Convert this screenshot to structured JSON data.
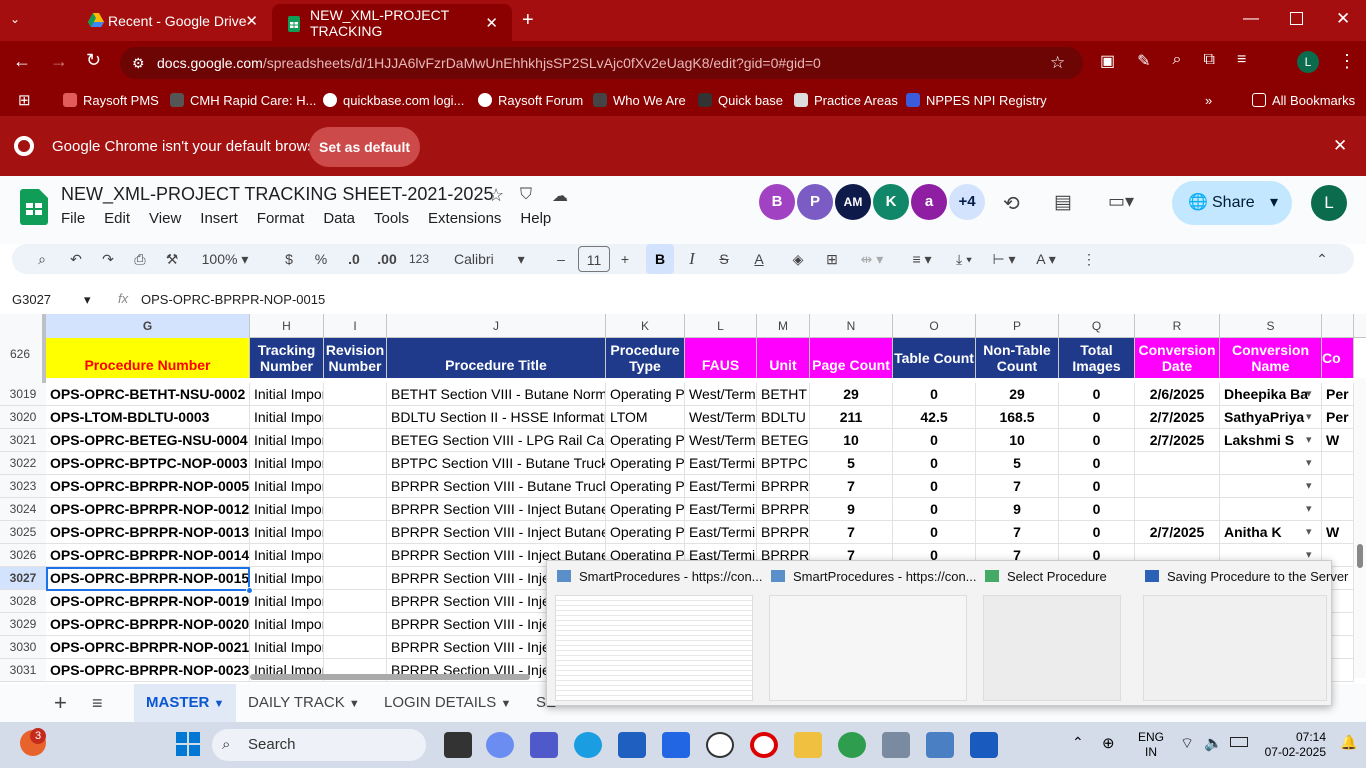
{
  "browser": {
    "tabs": [
      {
        "label": "Recent - Google Drive",
        "active": false
      },
      {
        "label": "NEW_XML-PROJECT TRACKING",
        "active": true
      }
    ],
    "url_host": "docs.google.com",
    "url_path": "/spreadsheets/d/1HJJA6lvFzrDaMwUnEhhkhjsSP2SLvAjc0fXv2eUagK8/edit?gid=0#gid=0",
    "bookmarks": [
      "Raysoft PMS",
      "CMH Rapid Care: H...",
      "quickbase.com logi...",
      "Raysoft Forum",
      "Who We Are",
      "Quick base",
      "Practice Areas",
      "NPPES NPI Registry"
    ],
    "all_bookmarks": "All Bookmarks",
    "infobar_text": "Google Chrome isn't your default browser",
    "set_default": "Set as default"
  },
  "sheet": {
    "title": "NEW_XML-PROJECT TRACKING SHEET-2021-2025",
    "menus": [
      "File",
      "Edit",
      "View",
      "Insert",
      "Format",
      "Data",
      "Tools",
      "Extensions",
      "Help"
    ],
    "avatars": [
      {
        "l": "B",
        "c": "#a142c2"
      },
      {
        "l": "P",
        "c": "#7b5cc4"
      },
      {
        "l": "AM",
        "c": "#0e1a4a"
      },
      {
        "l": "K",
        "c": "#11876a"
      },
      {
        "l": "a",
        "c": "#8e1fa3"
      },
      {
        "l": "+4",
        "c": "#d3e3fd"
      }
    ],
    "share": "Share",
    "user_initial": "L",
    "toolbar": {
      "zoom": "100%",
      "currency": "$",
      "percent": "%",
      "dec_less": ".0",
      "dec_more": ".00",
      "fmt123": "123",
      "font": "Calibri",
      "font_size": "11",
      "bold": "B",
      "italic": "I",
      "strike": "S",
      "textcolor": "A"
    },
    "namebox": "G3027",
    "formula": "OPS-OPRC-BPRPR-NOP-0015",
    "frozen_rows": "626",
    "columns": [
      "G",
      "H",
      "I",
      "J",
      "K",
      "L",
      "M",
      "N",
      "O",
      "P",
      "Q",
      "R",
      "S",
      ""
    ],
    "headers": [
      "Procedure Number",
      "Tracking Number",
      "Revision Number",
      "Procedure Title",
      "Procedure Type",
      "FAUS",
      "Unit",
      "Page Count",
      "Table Count",
      "Non-Table Count",
      "Total Images",
      "Conversion Date",
      "Conversion Name",
      "Co"
    ],
    "rows": [
      {
        "n": "3019",
        "c": [
          "OPS-OPRC-BETHT-NSU-0002",
          "Initial Impor",
          "",
          "BETHT Section VIII - Butane Normal S",
          "Operating Pr",
          "West/Termi",
          "BETHT",
          "29",
          "0",
          "29",
          "0",
          "2/6/2025",
          "Dheepika Ba",
          "Per"
        ]
      },
      {
        "n": "3020",
        "c": [
          "OPS-LTOM-BDLTU-0003",
          "Initial Impor",
          "",
          "BDLTU Section II - HSSE Information",
          "LTOM",
          "West/Termi",
          "BDLTU",
          "211",
          "42.5",
          "168.5",
          "0",
          "2/7/2025",
          "SathyaPriya",
          "Per"
        ]
      },
      {
        "n": "3021",
        "c": [
          "OPS-OPRC-BETEG-NSU-0004",
          "Initial Impor",
          "",
          "BETEG Section VIII - LPG Rail Car Unl",
          "Operating Pr",
          "West/Termi",
          "BETEG",
          "10",
          "0",
          "10",
          "0",
          "2/7/2025",
          "Lakshmi S",
          "W"
        ]
      },
      {
        "n": "3022",
        "c": [
          "OPS-OPRC-BPTPC-NOP-0003",
          "Initial Impor",
          "",
          "BPTPC Section VIII - Butane Truck Un",
          "Operating Pr",
          "East/Termir",
          "BPTPC",
          "5",
          "0",
          "5",
          "0",
          "",
          "",
          ""
        ]
      },
      {
        "n": "3023",
        "c": [
          "OPS-OPRC-BPRPR-NOP-0005",
          "Initial Impor",
          "",
          "BPRPR Section VIII - Butane Truck Un",
          "Operating Pr",
          "East/Termir",
          "BPRPR",
          "7",
          "0",
          "7",
          "0",
          "",
          "",
          ""
        ]
      },
      {
        "n": "3024",
        "c": [
          "OPS-OPRC-BPRPR-NOP-0012",
          "Initial Impor",
          "",
          "BPRPR Section VIII - Inject Butane fro",
          "Operating Pr",
          "East/Termir",
          "BPRPR",
          "9",
          "0",
          "9",
          "0",
          "",
          "",
          ""
        ]
      },
      {
        "n": "3025",
        "c": [
          "OPS-OPRC-BPRPR-NOP-0013",
          "Initial Impor",
          "",
          "BPRPR Section VIII - Inject Butane fro",
          "Operating Pr",
          "East/Termir",
          "BPRPR",
          "7",
          "0",
          "7",
          "0",
          "2/7/2025",
          "Anitha K",
          "W"
        ]
      },
      {
        "n": "3026",
        "c": [
          "OPS-OPRC-BPRPR-NOP-0014",
          "Initial Impor",
          "",
          "BPRPR Section VIII - Inject Butane fro",
          "Operating Pr",
          "East/Termir",
          "BPRPR",
          "7",
          "0",
          "7",
          "0",
          "",
          "",
          ""
        ]
      },
      {
        "n": "3027",
        "c": [
          "OPS-OPRC-BPRPR-NOP-0015",
          "Initial Impor",
          "",
          "BPRPR Section VIII - Inject",
          "",
          "",
          "",
          "",
          "",
          "",
          "",
          "",
          "",
          ""
        ]
      },
      {
        "n": "3028",
        "c": [
          "OPS-OPRC-BPRPR-NOP-0019",
          "Initial Impor",
          "",
          "BPRPR Section VIII - Inject",
          "",
          "",
          "",
          "",
          "",
          "",
          "",
          "",
          "",
          ""
        ]
      },
      {
        "n": "3029",
        "c": [
          "OPS-OPRC-BPRPR-NOP-0020",
          "Initial Impor",
          "",
          "BPRPR Section VIII - Inject",
          "",
          "",
          "",
          "",
          "",
          "",
          "",
          "",
          "",
          ""
        ]
      },
      {
        "n": "3030",
        "c": [
          "OPS-OPRC-BPRPR-NOP-0021",
          "Initial Impor",
          "",
          "BPRPR Section VIII - Inject",
          "",
          "",
          "",
          "",
          "",
          "",
          "",
          "",
          "",
          ""
        ]
      },
      {
        "n": "3031",
        "c": [
          "OPS-OPRC-BPRPR-NOP-0023",
          "Initial Impor",
          "",
          "BPRPR Section VIII - Inject",
          "",
          "",
          "",
          "",
          "",
          "",
          "",
          "",
          "",
          ""
        ]
      }
    ],
    "sheet_tabs": [
      "MASTER",
      "DAILY TRACK",
      "LOGIN DETAILS",
      "SE"
    ]
  },
  "taskbar_preview": [
    {
      "title": "SmartProcedures - https://con..."
    },
    {
      "title": "SmartProcedures - https://con..."
    },
    {
      "title": "Select Procedure"
    },
    {
      "title": "Saving Procedure to the Server"
    }
  ],
  "taskbar": {
    "search": "Search",
    "notif": "3",
    "lang1": "ENG",
    "lang2": "IN",
    "time": "07:14",
    "date": "07-02-2025"
  },
  "colors": {
    "yellow": "#ffff00",
    "blue": "#1f3a8a",
    "magenta": "#ff00ff",
    "chrome_red": "#8b0000"
  }
}
